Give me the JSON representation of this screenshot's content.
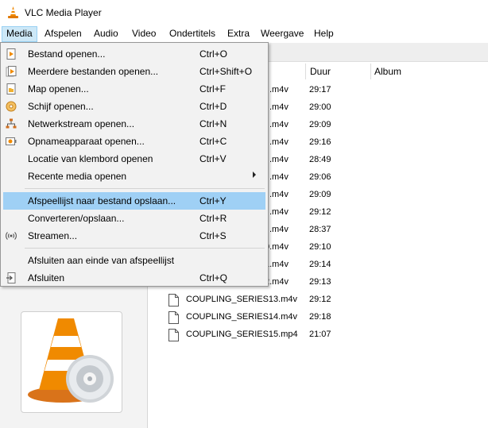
{
  "window": {
    "title": "VLC Media Player"
  },
  "menubar": {
    "items": [
      {
        "label": "Media"
      },
      {
        "label": "Afspelen"
      },
      {
        "label": "Audio"
      },
      {
        "label": "Video"
      },
      {
        "label": "Ondertitels"
      },
      {
        "label": "Extra"
      },
      {
        "label": "Weergave"
      },
      {
        "label": "Help"
      }
    ]
  },
  "media_menu": {
    "items": [
      {
        "label": "Bestand openen...",
        "shortcut": "Ctrl+O",
        "icon": "file-play-icon"
      },
      {
        "label": "Meerdere bestanden openen...",
        "shortcut": "Ctrl+Shift+O",
        "icon": "files-play-icon"
      },
      {
        "label": "Map openen...",
        "shortcut": "Ctrl+F",
        "icon": "folder-icon"
      },
      {
        "label": "Schijf openen...",
        "shortcut": "Ctrl+D",
        "icon": "disc-icon"
      },
      {
        "label": "Netwerkstream openen...",
        "shortcut": "Ctrl+N",
        "icon": "network-icon"
      },
      {
        "label": "Opnameapparaat openen...",
        "shortcut": "Ctrl+C",
        "icon": "capture-device-icon"
      },
      {
        "label": "Locatie van klembord openen",
        "shortcut": "Ctrl+V",
        "icon": ""
      },
      {
        "label": "Recente media openen",
        "shortcut": "",
        "icon": ""
      },
      {
        "label": "Afspeellijst naar bestand opslaan...",
        "shortcut": "Ctrl+Y",
        "icon": ""
      },
      {
        "label": "Converteren/opslaan...",
        "shortcut": "Ctrl+R",
        "icon": ""
      },
      {
        "label": "Streamen...",
        "shortcut": "Ctrl+S",
        "icon": "stream-icon"
      },
      {
        "label": "Afsluiten aan einde van afspeellijst",
        "shortcut": "",
        "icon": ""
      },
      {
        "label": "Afsluiten",
        "shortcut": "Ctrl+Q",
        "icon": "exit-icon"
      }
    ],
    "highlighted_index": 8
  },
  "playlist": {
    "columns": {
      "duration": "Duur",
      "album": "Album"
    },
    "rows": [
      {
        "name_fragment": ".m4v",
        "duration": "29:17"
      },
      {
        "name_fragment": ".m4v",
        "duration": "29:00"
      },
      {
        "name_fragment": ".m4v",
        "duration": "29:09"
      },
      {
        "name_fragment": ".m4v",
        "duration": "29:16"
      },
      {
        "name_fragment": ".m4v",
        "duration": "28:49"
      },
      {
        "name_fragment": ".m4v",
        "duration": "29:06"
      },
      {
        "name_fragment": ".m4v",
        "duration": "29:09"
      },
      {
        "name_fragment": ".m4v",
        "duration": "29:12"
      },
      {
        "name_fragment": ".m4v",
        "duration": "28:37"
      },
      {
        "name_fragment": "0.m4v",
        "duration": "29:10"
      },
      {
        "name_fragment": "1.m4v",
        "duration": "29:14"
      },
      {
        "name_fragment": "2.m4v",
        "duration": "29:13"
      },
      {
        "name": "COUPLING_SERIES13.m4v",
        "duration": "29:12"
      },
      {
        "name": "COUPLING_SERIES14.m4v",
        "duration": "29:18"
      },
      {
        "name": "COUPLING_SERIES15.mp4",
        "duration": "21:07"
      }
    ]
  },
  "colors": {
    "menu_highlight": "#9fd0f5",
    "menubar_active": "#cde8f7",
    "vlc_orange": "#f08a00"
  }
}
